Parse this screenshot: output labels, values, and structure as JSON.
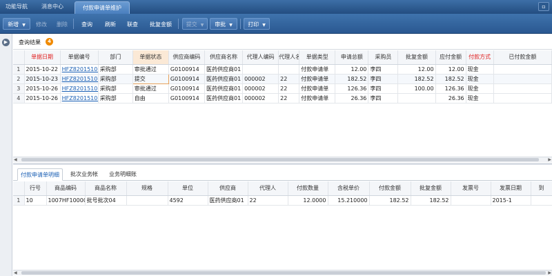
{
  "top_tabs": [
    "功能导航",
    "消息中心",
    "付款申请单维护"
  ],
  "window_button": "▫",
  "toolbar": {
    "new": "新增",
    "edit": "修改",
    "delete": "删除",
    "query": "查询",
    "refresh": "刷新",
    "audit": "联查",
    "batch": "批复金额",
    "submit": "提交",
    "approve": "审批",
    "print": "打印"
  },
  "query": {
    "title": "查询结果",
    "count": "4"
  },
  "main_table": {
    "headers": [
      "单据日期",
      "单据编号",
      "部门",
      "单据状态",
      "供应商编码",
      "供应商名称",
      "代理人编码",
      "代理人名...",
      "单据类型",
      "申请总额",
      "采购员",
      "批复金额",
      "应付金额",
      "付款方式",
      "已付款金额"
    ],
    "rows": [
      [
        "1",
        "2015-10-22",
        "HFZ820151022(",
        "采购部",
        "审批通过",
        "G0100914",
        "医药供应商01",
        "",
        "",
        "付款申请单",
        "12.00",
        "李四",
        "12.00",
        "12.00",
        "现金",
        ""
      ],
      [
        "2",
        "2015-10-23",
        "HFZ820151023(",
        "采购部",
        "提交",
        "G0100914",
        "医药供应商01",
        "000002",
        "22",
        "付款申请单",
        "182.52",
        "李四",
        "182.52",
        "182.52",
        "现金",
        ""
      ],
      [
        "3",
        "2015-10-26",
        "HFZ820151026(",
        "采购部",
        "审批通过",
        "G0100914",
        "医药供应商01",
        "000002",
        "22",
        "付款申请单",
        "126.36",
        "李四",
        "100.00",
        "126.36",
        "现金",
        ""
      ],
      [
        "4",
        "2015-10-26",
        "HFZ820151026(",
        "采购部",
        "自由",
        "G0100914",
        "医药供应商01",
        "000002",
        "22",
        "付款申请单",
        "26.36",
        "李四",
        "",
        "26.36",
        "现金",
        ""
      ]
    ]
  },
  "sub_tabs": [
    "付款申请单明细",
    "批次业务帐",
    "业务明细账"
  ],
  "detail_table": {
    "headers": [
      "行号",
      "商品编码",
      "商品名称",
      "规格",
      "单位",
      "供应商",
      "代理人",
      "付款数量",
      "含税单价",
      "付款金额",
      "批复金额",
      "发票号",
      "发票日期",
      "到"
    ],
    "rows": [
      [
        "1",
        "10",
        "1007HF100000...",
        "批号批次04",
        "",
        "4592",
        "医药供应商01",
        "22",
        "12.0000",
        "15.210000",
        "182.52",
        "182.52",
        "",
        "2015-1"
      ]
    ]
  }
}
